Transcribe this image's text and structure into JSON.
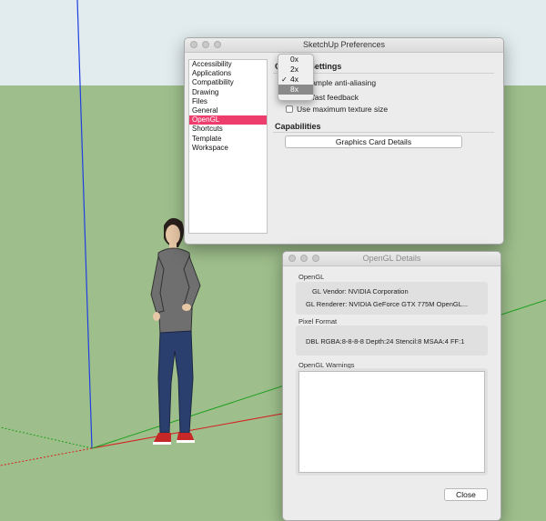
{
  "preferences": {
    "title": "SketchUp Preferences",
    "categories": [
      "Accessibility",
      "Applications",
      "Compatibility",
      "Drawing",
      "Files",
      "General",
      "OpenGL",
      "Shortcuts",
      "Template",
      "Workspace"
    ],
    "selected_category": "OpenGL",
    "settings_heading": "OpenGL Settings",
    "multisample_label": "Multisample anti-aliasing",
    "fast_feedback_label": "Use fast feedback",
    "max_texture_label": "Use maximum texture size",
    "capabilities_heading": "Capabilities",
    "graphics_card_button": "Graphics Card Details"
  },
  "aa_dropdown": {
    "options": [
      "0x",
      "2x",
      "4x",
      "8x"
    ],
    "selected": "4x",
    "highlighted": "8x"
  },
  "opengl_details": {
    "title": "OpenGL Details",
    "opengl_label": "OpenGL",
    "vendor_line": "GL Vendor: NVIDIA Corporation",
    "renderer_line": "GL Renderer: NVIDIA GeForce GTX 775M OpenGL...",
    "pixel_format_label": "Pixel Format",
    "pixel_format_line": "DBL RGBA:8-8-8-8 Depth:24 Stencil:8 MSAA:4 FF:1",
    "warnings_label": "OpenGL Warnings",
    "close_button": "Close"
  },
  "colors": {
    "selection": "#ec3d6d",
    "ground": "#9ebf8c",
    "sky": "#e2ecee"
  }
}
